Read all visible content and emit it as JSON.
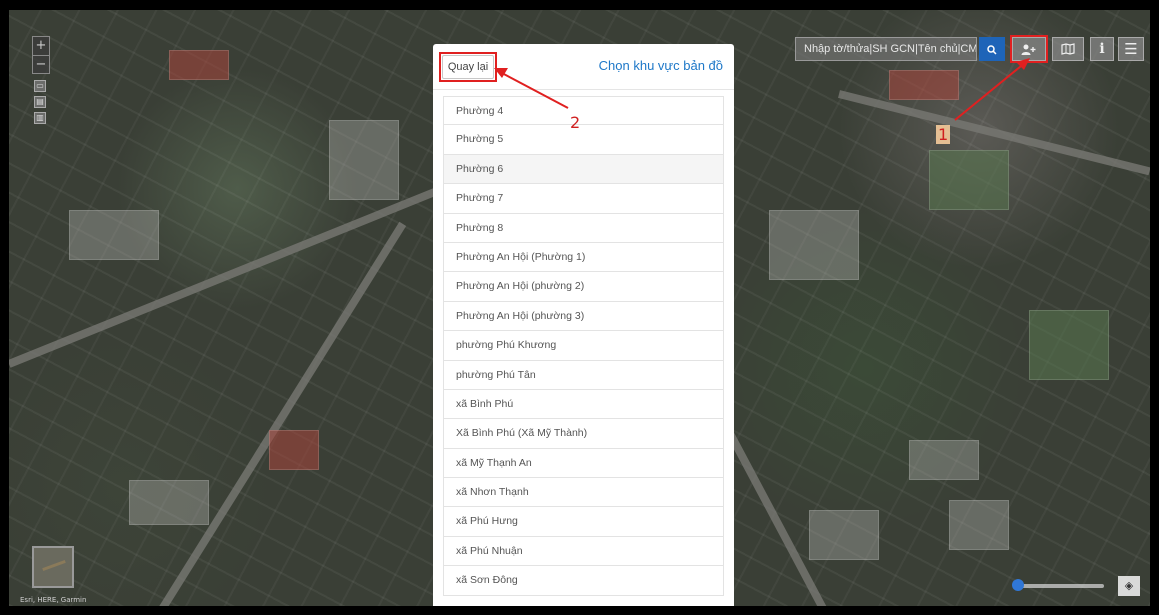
{
  "search": {
    "placeholder": "Nhập tờ/thửa|SH GCN|Tên chủ|CMND",
    "button_icon": "search-icon"
  },
  "toolbar": {
    "user_icon": "user-plus-icon",
    "map_icon": "map-icon",
    "info_icon": "info-icon",
    "menu_icon": "menu-icon"
  },
  "map_controls": {
    "zoom_in": "+",
    "zoom_out": "−",
    "attribution": "Esri, HERE, Garmin"
  },
  "panel": {
    "back_label": "Quay lại",
    "title": "Chọn khu vực bản đồ",
    "items": [
      "Phường 4",
      "Phường 5",
      "Phường 6",
      "Phường 7",
      "Phường 8",
      "Phường An Hội (Phường 1)",
      "Phường An Hội (phường 2)",
      "Phường An Hội (phường 3)",
      "phường Phú Khương",
      "phường Phú Tân",
      "xã Bình Phú",
      "Xã Bình Phú (Xã Mỹ Thành)",
      "xã Mỹ Thạnh An",
      "xã Nhơn Thạnh",
      "xã Phú Hưng",
      "xã Phú Nhuận",
      "xã Sơn Đông"
    ],
    "hovered_index": 2
  },
  "annotations": {
    "label_1": "1",
    "label_2": "2",
    "color": "#e02020"
  },
  "colors": {
    "accent": "#1e78c8",
    "search_button": "#1e64b8"
  }
}
